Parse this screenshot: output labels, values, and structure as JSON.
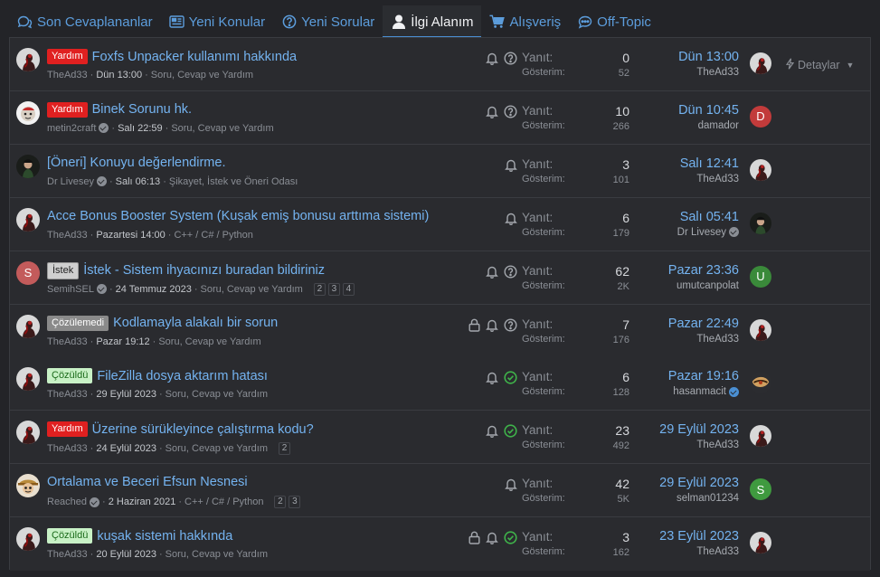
{
  "tabs": [
    {
      "label": "Son Cevaplananlar",
      "icon": "comments-icon"
    },
    {
      "label": "Yeni Konular",
      "icon": "newspaper-icon"
    },
    {
      "label": "Yeni Sorular",
      "icon": "question-circle-icon"
    },
    {
      "label": "İlgi Alanım",
      "icon": "user-icon",
      "active": true
    },
    {
      "label": "Alışveriş",
      "icon": "cart-icon"
    },
    {
      "label": "Off-Topic",
      "icon": "chat-icon"
    }
  ],
  "stat_labels": {
    "replies": "Yanıt:",
    "views": "Gösterim:"
  },
  "details_label": "Detaylar",
  "threads": [
    {
      "label": "Yardım",
      "label_style": "red",
      "title": "Foxfs Unpacker kullanımı hakkında",
      "author": "TheAd33",
      "date": "Dün 13:00",
      "forum": "Soru, Cevap ve Yardım",
      "replies": "0",
      "views": "52",
      "last_date": "Dün 13:00",
      "last_user": "TheAd33",
      "icons": [
        "bell-icon",
        "question-icon"
      ],
      "avatar": "thead",
      "last_avatar": "thead"
    },
    {
      "label": "Yardım",
      "label_style": "red",
      "title": "Binek Sorunu hk.",
      "author": "metin2craft",
      "verified": true,
      "date": "Salı 22:59",
      "forum": "Soru, Cevap ve Yardım",
      "replies": "10",
      "views": "266",
      "last_date": "Dün 10:45",
      "last_user": "damador",
      "icons": [
        "bell-icon",
        "question-icon"
      ],
      "avatar": "metin",
      "last_avatar": "D",
      "last_avatar_color": "#c23b3b"
    },
    {
      "label": "",
      "title": "[Öneri] Konuyu değerlendirme.",
      "author": "Dr Livesey",
      "verified": true,
      "date": "Salı 06:13",
      "forum": "Şikayet, İstek ve Öneri Odası",
      "replies": "3",
      "views": "101",
      "last_date": "Salı 12:41",
      "last_user": "TheAd33",
      "icons": [
        "bell-icon"
      ],
      "avatar": "livesey",
      "last_avatar": "thead"
    },
    {
      "label": "",
      "title": "Acce Bonus Booster System (Kuşak emiş bonusu arttıma sistemi)",
      "author": "TheAd33",
      "date": "Pazartesi 14:00",
      "forum": "C++ / C# / Python",
      "replies": "6",
      "views": "179",
      "last_date": "Salı 05:41",
      "last_user": "Dr Livesey",
      "last_verified": true,
      "icons": [
        "bell-icon"
      ],
      "avatar": "thead",
      "last_avatar": "livesey"
    },
    {
      "label": "İstek",
      "label_style": "silver",
      "title": "İstek - Sistem ihyacınızı buradan bildiriniz",
      "author": "SemihSEL",
      "verified": true,
      "date": "24 Temmuz 2023",
      "forum": "Soru, Cevap ve Yardım",
      "pages": [
        "2",
        "3",
        "4"
      ],
      "replies": "62",
      "views": "2K",
      "last_date": "Pazar 23:36",
      "last_user": "umutcanpolat",
      "icons": [
        "bell-icon",
        "question-icon"
      ],
      "avatar": "S",
      "avatar_color": "#c35b5b",
      "last_avatar": "U",
      "last_avatar_color": "#3a8a3a"
    },
    {
      "label": "Çözülemedi",
      "label_style": "gray",
      "title": "Kodlamayla alakalı bir sorun",
      "author": "TheAd33",
      "date": "Pazar 19:12",
      "forum": "Soru, Cevap ve Yardım",
      "replies": "7",
      "views": "176",
      "last_date": "Pazar 22:49",
      "last_user": "TheAd33",
      "icons": [
        "lock-icon",
        "bell-icon",
        "question-icon"
      ],
      "avatar": "thead",
      "last_avatar": "thead"
    },
    {
      "label": "Çözüldü",
      "label_style": "green",
      "title": "FileZilla dosya aktarım hatası",
      "author": "TheAd33",
      "date": "29 Eylül 2023",
      "forum": "Soru, Cevap ve Yardım",
      "replies": "6",
      "views": "128",
      "last_date": "Pazar 19:16",
      "last_user": "hasanmacit",
      "last_verified_blue": true,
      "icons": [
        "bell-icon",
        "check-circle-icon"
      ],
      "avatar": "thead",
      "last_avatar": "hasan"
    },
    {
      "label": "Yardım",
      "label_style": "red",
      "title": "Üzerine sürükleyince çalıştırma kodu?",
      "author": "TheAd33",
      "date": "24 Eylül 2023",
      "forum": "Soru, Cevap ve Yardım",
      "pages": [
        "2"
      ],
      "replies": "23",
      "views": "492",
      "last_date": "29 Eylül 2023",
      "last_user": "TheAd33",
      "icons": [
        "bell-icon",
        "check-circle-icon"
      ],
      "avatar": "thead",
      "last_avatar": "thead"
    },
    {
      "label": "",
      "title": "Ortalama ve Beceri Efsun Nesnesi",
      "author": "Reached",
      "verified": true,
      "date": "2 Haziran 2021",
      "forum": "C++ / C# / Python",
      "pages": [
        "2",
        "3"
      ],
      "replies": "42",
      "views": "5K",
      "last_date": "29 Eylül 2023",
      "last_user": "selman01234",
      "icons": [
        "bell-icon"
      ],
      "avatar": "reached",
      "last_avatar": "S",
      "last_avatar_color": "#3f9a3f"
    },
    {
      "label": "Çözüldü",
      "label_style": "green",
      "title": "kuşak sistemi hakkında",
      "author": "TheAd33",
      "date": "20 Eylül 2023",
      "forum": "Soru, Cevap ve Yardım",
      "replies": "3",
      "views": "162",
      "last_date": "23 Eylül 2023",
      "last_user": "TheAd33",
      "icons": [
        "lock-icon",
        "bell-icon",
        "check-circle-icon"
      ],
      "avatar": "thead",
      "last_avatar": "thead"
    }
  ]
}
